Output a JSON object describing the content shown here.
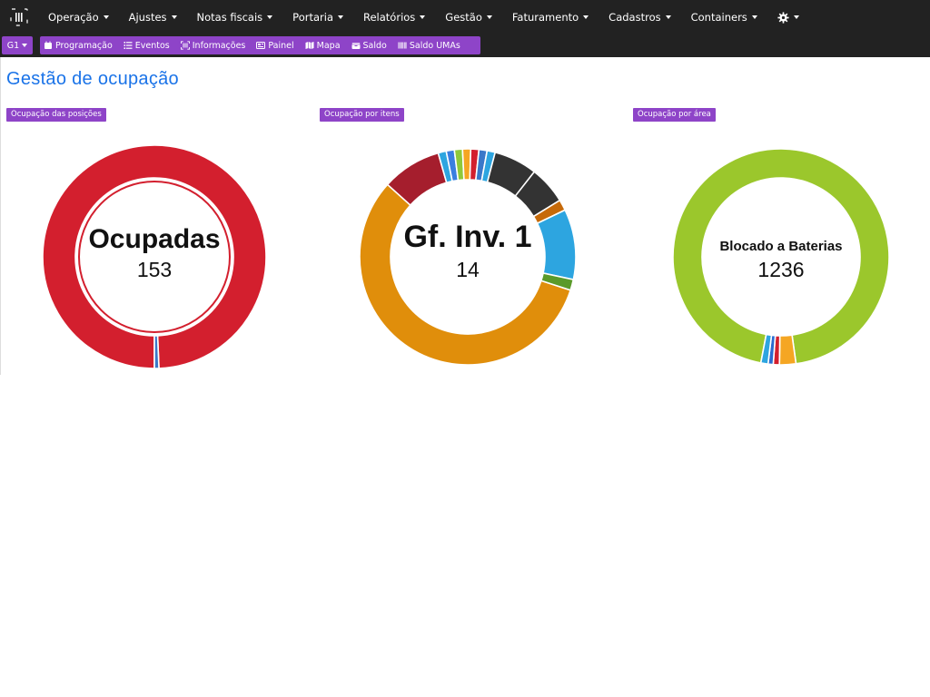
{
  "topnav": {
    "items": [
      {
        "label": "Operação"
      },
      {
        "label": "Ajustes"
      },
      {
        "label": "Notas fiscais"
      },
      {
        "label": "Portaria"
      },
      {
        "label": "Relatórios"
      },
      {
        "label": "Gestão"
      },
      {
        "label": "Faturamento"
      },
      {
        "label": "Cadastros"
      },
      {
        "label": "Containers"
      }
    ]
  },
  "subnav": {
    "group": "G1",
    "items": [
      {
        "label": "Programação",
        "icon": "calendar-icon"
      },
      {
        "label": "Eventos",
        "icon": "list-icon"
      },
      {
        "label": "Informações",
        "icon": "barcode-icon"
      },
      {
        "label": "Painel",
        "icon": "panel-icon"
      },
      {
        "label": "Mapa",
        "icon": "map-icon"
      },
      {
        "label": "Saldo",
        "icon": "box-icon"
      },
      {
        "label": "Saldo UMAs",
        "icon": "barcode-icon"
      }
    ]
  },
  "page": {
    "title": "Gestão de ocupação"
  },
  "colors": {
    "accent": "#8e44c8",
    "topbar": "#222222",
    "title": "#1a73e8"
  },
  "chart_data": [
    {
      "type": "pie",
      "badge": "Ocupação das posições",
      "center_label": "Ocupadas",
      "center_value": "153",
      "slices": [
        {
          "value": 153,
          "color": "#d31f2e"
        },
        {
          "value": 1,
          "color": "#3a78c9"
        }
      ]
    },
    {
      "type": "pie",
      "badge": "Ocupação por itens",
      "center_label": "Gf. Inv. 1",
      "center_value": "14",
      "slices": [
        {
          "value": 14,
          "color": "#e08e0b"
        },
        {
          "value": 2.2,
          "color": "#a51e2d"
        },
        {
          "value": 0.3,
          "color": "#2da5e0"
        },
        {
          "value": 0.3,
          "color": "#3a7fe0"
        },
        {
          "value": 0.3,
          "color": "#8fc93a"
        },
        {
          "value": 0.3,
          "color": "#f5a623"
        },
        {
          "value": 0.3,
          "color": "#d31f2e"
        },
        {
          "value": 0.3,
          "color": "#3a78c9"
        },
        {
          "value": 0.3,
          "color": "#2da5e0"
        },
        {
          "value": 1.6,
          "color": "#333333"
        },
        {
          "value": 1.4,
          "color": "#333333"
        },
        {
          "value": 0.4,
          "color": "#c66a0a"
        },
        {
          "value": 2.6,
          "color": "#2da5e0"
        },
        {
          "value": 0.4,
          "color": "#5a9a2a"
        }
      ]
    },
    {
      "type": "pie",
      "badge": "Ocupação por área",
      "center_label": "Blocado a Baterias",
      "center_value": "1236",
      "slices": [
        {
          "value": 1236,
          "color": "#9bc72c"
        },
        {
          "value": 32,
          "color": "#f5a623"
        },
        {
          "value": 12,
          "color": "#d31f2e"
        },
        {
          "value": 10,
          "color": "#2a6bd0"
        },
        {
          "value": 14,
          "color": "#2da5e0"
        }
      ]
    }
  ]
}
